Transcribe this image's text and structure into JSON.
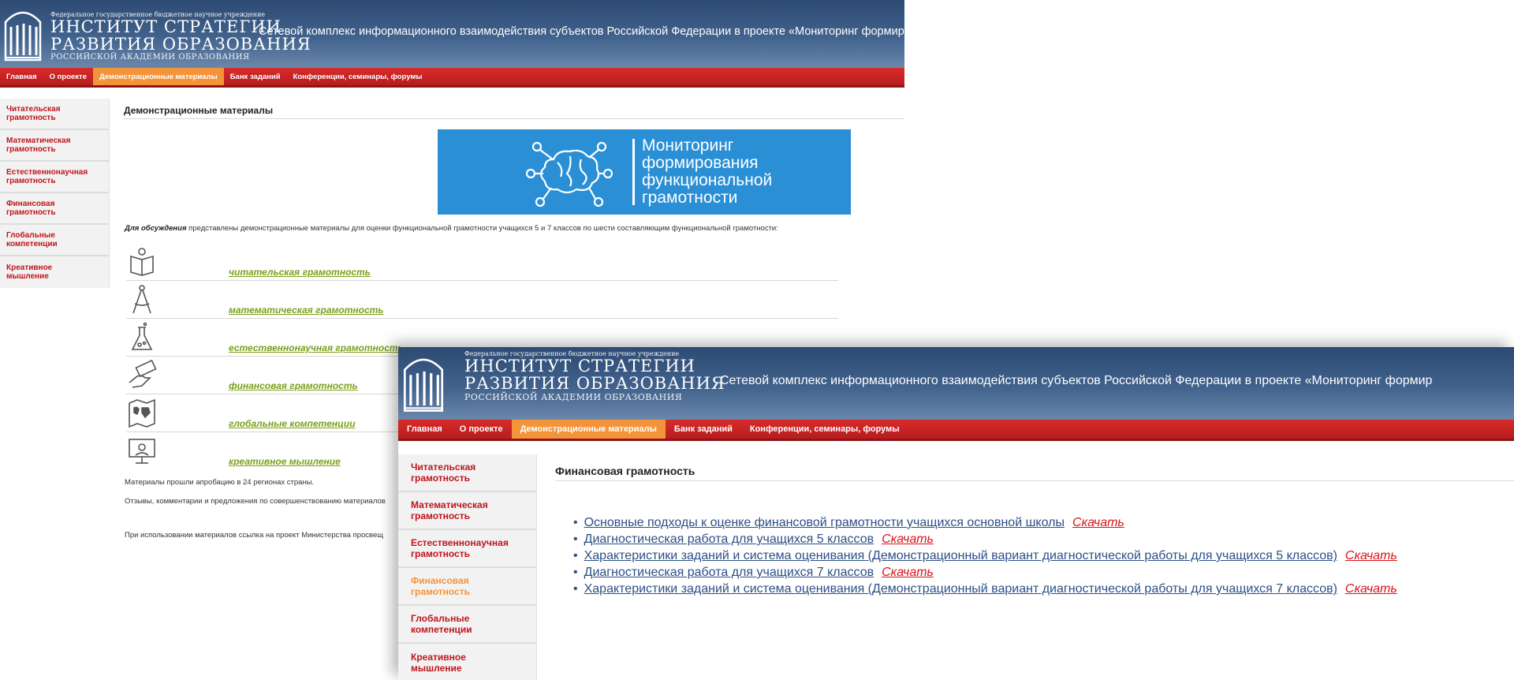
{
  "site": {
    "org_line": "Федеральное государственное бюджетное научное учреждение",
    "logo_line1": "ИНСТИТУТ СТРАТЕГИИ",
    "logo_line2": "РАЗВИТИЯ ОБРАЗОВАНИЯ",
    "logo_line3": "РОССИЙСКОЙ АКАДЕМИИ ОБРАЗОВАНИЯ",
    "title": "Сетевой комплекс информационного взаимодействия субъектов Российской Федерации в проекте «Мониторинг формир"
  },
  "nav": [
    "Главная",
    "О проекте",
    "Демонстрационные материалы",
    "Банк заданий",
    "Конференции, семинары, форумы"
  ],
  "sidebar": [
    {
      "line1": "Читательская",
      "line2": "грамотность"
    },
    {
      "line1": "Математическая",
      "line2": "грамотность"
    },
    {
      "line1": "Естественнонаучная",
      "line2": "грамотность"
    },
    {
      "line1": "Финансовая",
      "line2": "грамотность"
    },
    {
      "line1": "Глобальные",
      "line2": "компетенции"
    },
    {
      "line1": "Креативное",
      "line2": "мышление"
    }
  ],
  "demo_page": {
    "heading": "Демонстрационные материалы",
    "hero": {
      "line1": "Мониторинг",
      "line2": "формирования",
      "line3": "функциональной",
      "line4": "грамотности"
    },
    "intro_bold": "Для обсуждения",
    "intro_text": " представлены демонстрационные материалы для оценки функциональной грамотности учащихся 5 и 7 классов по шести составляющим функциональной грамотности:",
    "links": [
      {
        "label": "читательская грамотность",
        "icon": "book-icon"
      },
      {
        "label": "математическая грамотность",
        "icon": "compass-icon"
      },
      {
        "label": "естественнонаучная грамотность",
        "icon": "flask-icon"
      },
      {
        "label": "финансовая грамотность",
        "icon": "money-hand-icon"
      },
      {
        "label": "глобальные компетенции",
        "icon": "world-map-icon"
      },
      {
        "label": "креативное мышление",
        "icon": "presentation-icon"
      }
    ],
    "note1": "Материалы прошли апробацию в 24 регионах страны.",
    "note2": "Отзывы, комментарии и предложения по совершенствованию материалов",
    "note3": "При использовании материалов ссылка на проект Министерства просвещ"
  },
  "finance_page": {
    "heading": "Финансовая грамотность",
    "download_label": "Скачать",
    "documents": [
      "Основные подходы к оценке финансовой грамотности учащихся основной школы",
      "Диагностическая работа для учащихся 5 классов",
      "Характеристики заданий и система оценивания (Демонстрационный вариант диагностической работы для учащихся 5 классов)",
      "Диагностическая работа для учащихся 7 классов",
      "Характеристики заданий и система оценивания (Демонстрационный вариант диагностической работы для учащихся 7 классов)"
    ]
  },
  "colors": {
    "banner": "#2d4a72",
    "nav_red": "#c62222",
    "nav_active": "#f3943a",
    "sidebar_link": "#c0141d",
    "lit_link": "#7aa01a",
    "hero_blue": "#2b8fd6",
    "download_red": "#d8131b"
  }
}
